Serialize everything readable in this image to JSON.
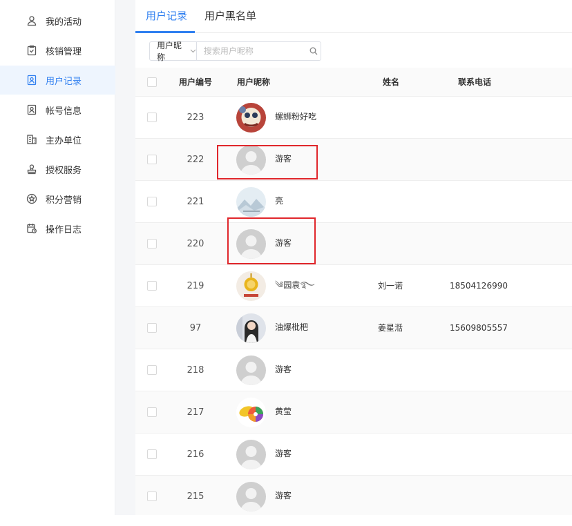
{
  "sidebar": {
    "items": [
      {
        "label": "我的活动",
        "icon": "user-icon"
      },
      {
        "label": "核销管理",
        "icon": "check-clipboard-icon"
      },
      {
        "label": "用户记录",
        "icon": "user-record-icon",
        "active": true
      },
      {
        "label": "帐号信息",
        "icon": "id-card-icon"
      },
      {
        "label": "主办单位",
        "icon": "building-icon"
      },
      {
        "label": "授权服务",
        "icon": "stamp-icon"
      },
      {
        "label": "积分营销",
        "icon": "star-circle-icon"
      },
      {
        "label": "操作日志",
        "icon": "calendar-log-icon"
      }
    ]
  },
  "tabs": [
    {
      "label": "用户记录",
      "active": true
    },
    {
      "label": "用户黑名单",
      "active": false
    }
  ],
  "search": {
    "field_label": "用户昵称",
    "placeholder": "搜索用户昵称"
  },
  "table": {
    "columns": [
      "用户编号",
      "用户昵称",
      "姓名",
      "联系电话"
    ],
    "rows": [
      {
        "id": "223",
        "nickname": "螺蛳粉好吃",
        "name": "",
        "phone": "",
        "avatar": "cartoon"
      },
      {
        "id": "222",
        "nickname": "游客",
        "name": "",
        "phone": "",
        "avatar": "default"
      },
      {
        "id": "221",
        "nickname": "亮",
        "name": "",
        "phone": "",
        "avatar": "landscape"
      },
      {
        "id": "220",
        "nickname": "游客",
        "name": "",
        "phone": "",
        "avatar": "default"
      },
      {
        "id": "219",
        "nickname": "园袁",
        "name": "刘一诺",
        "phone": "18504126990",
        "avatar": "gold"
      },
      {
        "id": "97",
        "nickname": "油爆枇杷",
        "name": "姜星湉",
        "phone": "15609805557",
        "avatar": "photo"
      },
      {
        "id": "218",
        "nickname": "游客",
        "name": "",
        "phone": "",
        "avatar": "default"
      },
      {
        "id": "217",
        "nickname": "黄莹",
        "name": "",
        "phone": "",
        "avatar": "fruit"
      },
      {
        "id": "216",
        "nickname": "游客",
        "name": "",
        "phone": "",
        "avatar": "default"
      },
      {
        "id": "215",
        "nickname": "游客",
        "name": "",
        "phone": "",
        "avatar": "default"
      }
    ]
  },
  "colors": {
    "accent": "#2f7ff0",
    "highlight": "#e0262b"
  }
}
